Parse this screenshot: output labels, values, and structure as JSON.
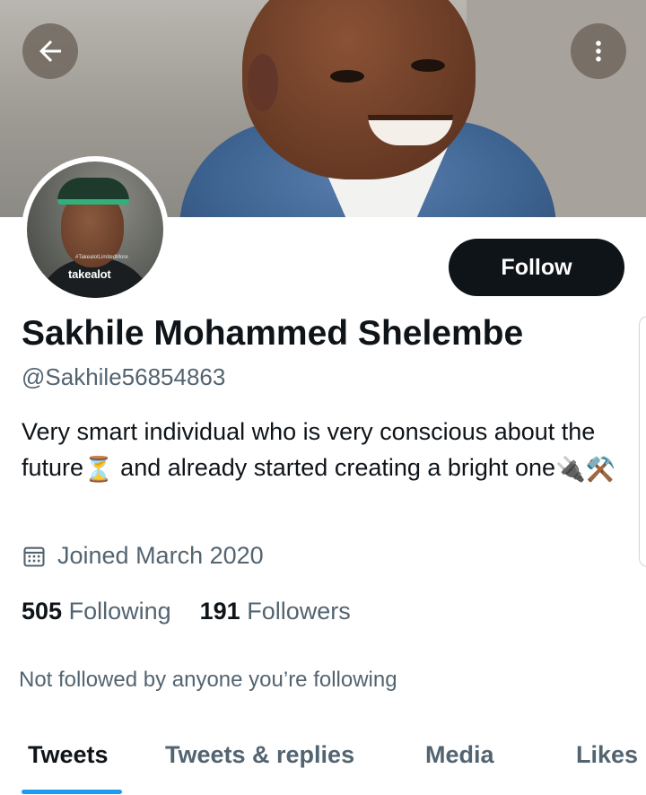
{
  "header": {
    "back_icon": "arrow-left-icon",
    "more_icon": "more-vertical-icon"
  },
  "avatar": {
    "brand_text": "takealot",
    "caption_text": "#TakealotLimitedMore"
  },
  "profile": {
    "follow_label": "Follow",
    "name": "Sakhile Mohammed Shelembe",
    "handle": "@Sakhile56854863",
    "bio_part1": "Very smart individual who is very conscious about the future",
    "bio_emoji1": "⏳",
    "bio_part2": " and already started creating a bright one",
    "bio_emoji2": "🔌⚒️",
    "joined_icon": "calendar-icon",
    "joined": "Joined March 2020"
  },
  "stats": {
    "following_count": "505",
    "following_label": "Following",
    "followers_count": "191",
    "followers_label": "Followers"
  },
  "social_context": "Not followed by anyone you’re following",
  "tabs": [
    {
      "label": "Tweets",
      "active": true
    },
    {
      "label": "Tweets & replies",
      "active": false
    },
    {
      "label": "Media",
      "active": false
    },
    {
      "label": "Likes",
      "active": false
    }
  ],
  "colors": {
    "accent": "#1d9bf0",
    "text_primary": "#0f1419",
    "text_secondary": "#536471",
    "button_dark": "#0f1419"
  }
}
